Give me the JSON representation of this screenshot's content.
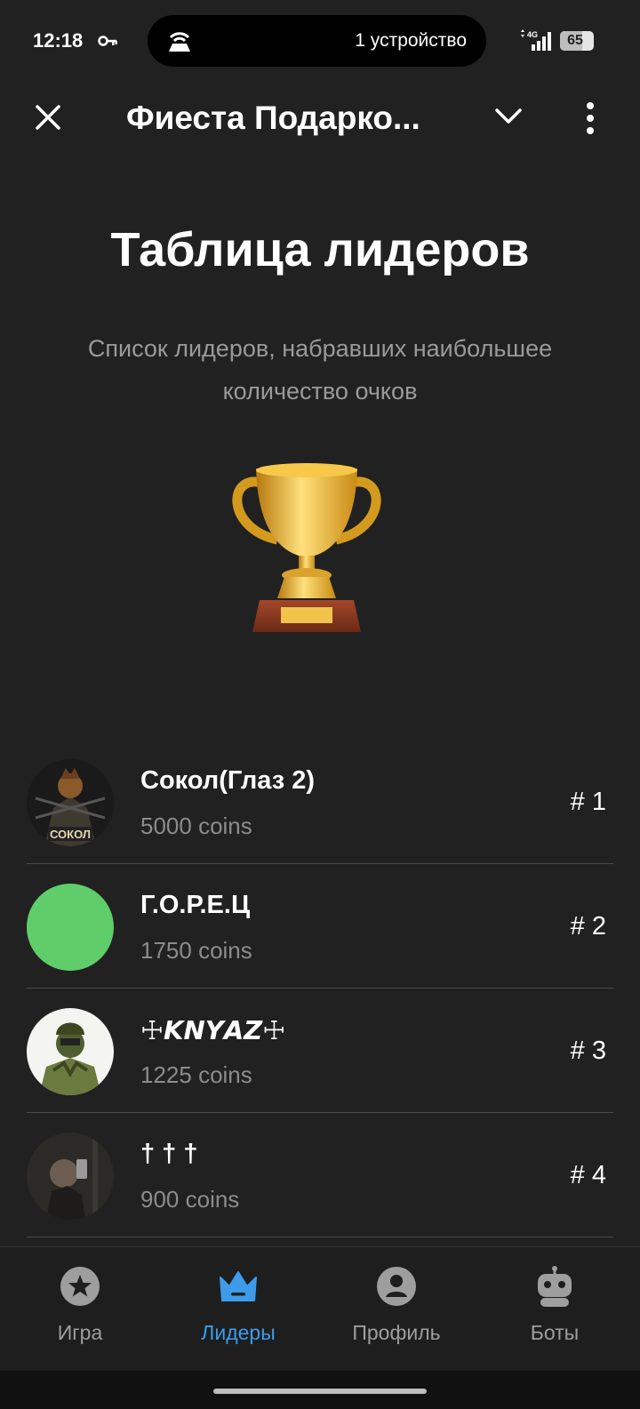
{
  "status_bar": {
    "time": "12:18",
    "island_text": "1 устройство",
    "network": "4G",
    "battery": "65",
    "battery_level": 0.65
  },
  "header": {
    "title": "Фиеста Подарко...",
    "close_icon": "close-icon",
    "chevron_icon": "chevron-down-icon",
    "menu_icon": "more-vertical-icon"
  },
  "main": {
    "title": "Таблица лидеров",
    "subtitle": "Список лидеров, набравших наибольшее количество очков",
    "image": "trophy-icon"
  },
  "leaders": [
    {
      "name": "Сокол(Глаз 2)",
      "coins": "5000 coins",
      "rank": "# 1",
      "avatar_label": "СОКОЛ"
    },
    {
      "name": "Г.О.Р.Е.Ц",
      "coins": "1750 coins",
      "rank": "# 2",
      "avatar_color": "#5fce6a"
    },
    {
      "name": "☩𝙆𝙉𝙔𝘼𝙕☩",
      "coins": "1225 coins",
      "rank": "# 3"
    },
    {
      "name": "† † †",
      "coins": "900 coins",
      "rank": "# 4"
    }
  ],
  "bottom_nav": [
    {
      "label": "Игра",
      "icon": "star-circle-icon",
      "active": false
    },
    {
      "label": "Лидеры",
      "icon": "crown-icon",
      "active": true
    },
    {
      "label": "Профиль",
      "icon": "profile-icon",
      "active": false
    },
    {
      "label": "Боты",
      "icon": "robot-icon",
      "active": false
    }
  ],
  "colors": {
    "background": "#212121",
    "accent": "#3d9be9",
    "muted_text": "#8c8c8c"
  }
}
